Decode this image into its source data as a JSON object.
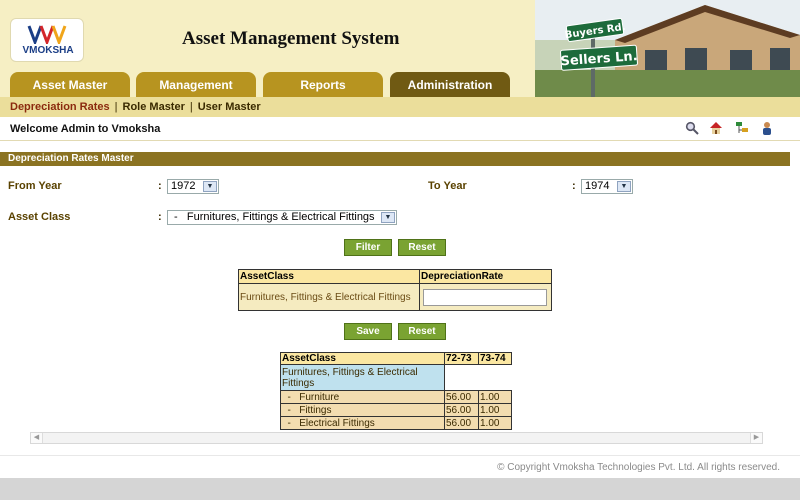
{
  "header": {
    "logo_text": "VMOKSHA",
    "app_title": "Asset Management System",
    "sign1": "Buyers Rd.",
    "sign2": "Sellers Ln."
  },
  "tabs": [
    {
      "label": "Asset Master"
    },
    {
      "label": "Management"
    },
    {
      "label": "Reports"
    },
    {
      "label": "Administration"
    }
  ],
  "subnav": {
    "items": [
      "Depreciation Rates",
      "Role Master",
      "User Master"
    ],
    "sep": "|"
  },
  "welcome": "Welcome Admin to Vmoksha",
  "section_title": "Depreciation Rates Master",
  "form": {
    "colon": ":",
    "from_year_label": "From Year",
    "from_year_value": "1972",
    "to_year_label": "To Year",
    "to_year_value": "1974",
    "asset_class_label": "Asset Class",
    "asset_class_value": " -   Furnitures, Fittings & Electrical Fittings",
    "filter_label": "Filter",
    "reset_label": "Reset",
    "save_label": "Save",
    "reset2_label": "Reset"
  },
  "rate_table": {
    "headers": [
      "AssetClass",
      "DepreciationRate"
    ],
    "row_class": "Furnitures, Fittings & Electrical Fittings",
    "rate_value": ""
  },
  "summary_table": {
    "headers": [
      "AssetClass",
      "72-73",
      "73-74"
    ],
    "group": "Furnitures, Fittings & Electrical Fittings",
    "rows": [
      {
        "name": "  -   Furniture",
        "v1": "56.00",
        "v2": "1.00"
      },
      {
        "name": "  -   Fittings",
        "v1": "56.00",
        "v2": "1.00"
      },
      {
        "name": "  -   Electrical Fittings",
        "v1": "56.00",
        "v2": "1.00"
      }
    ]
  },
  "footer": "© Copyright Vmoksha Technologies Pvt. Ltd. All rights reserved.",
  "colors": {
    "tab": "#b79420",
    "tab_active": "#705a13",
    "section": "#8b7322",
    "button": "#7aa332"
  }
}
